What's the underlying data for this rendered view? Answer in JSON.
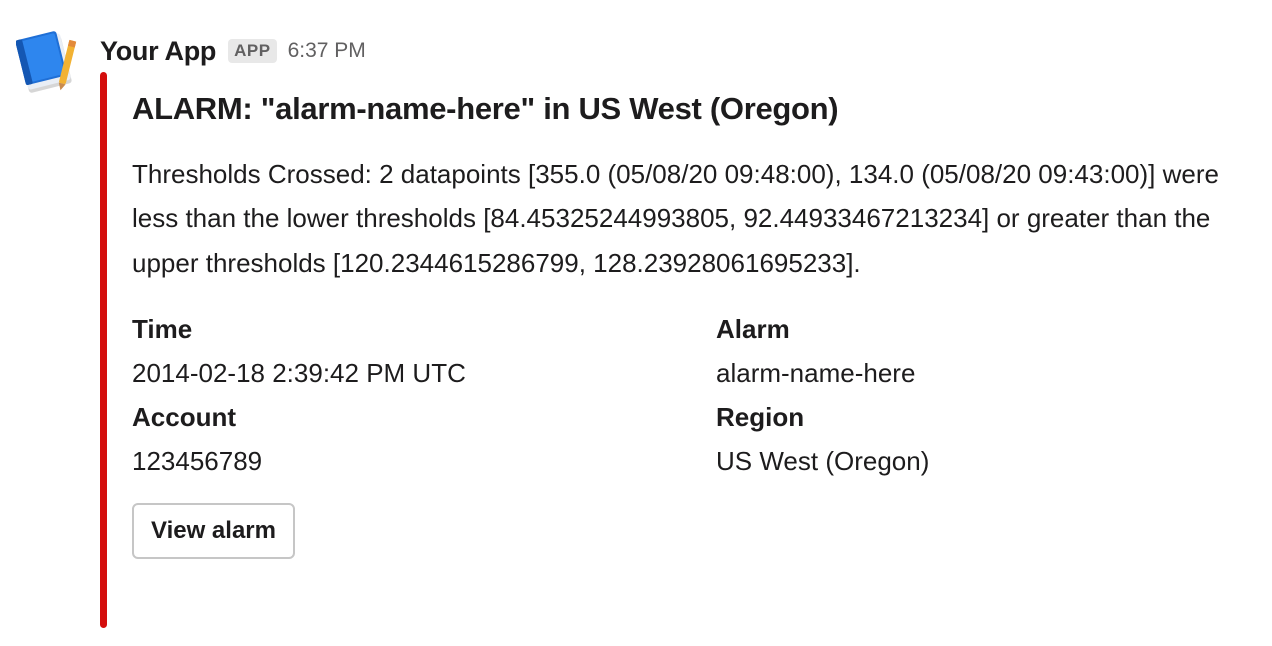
{
  "message": {
    "app_name": "Your App",
    "app_badge": "APP",
    "timestamp": "6:37 PM",
    "avatar_icon": "notebook-icon"
  },
  "attachment": {
    "color": "#d40e0d",
    "title": "ALARM: \"alarm-name-here\" in US West (Oregon)",
    "text": "Thresholds Crossed: 2 datapoints [355.0 (05/08/20 09:48:00), 134.0 (05/08/20 09:43:00)] were less than the lower thresholds [84.45325244993805, 92.44933467213234] or greater than the upper thresholds [120.2344615286799, 128.23928061695233].",
    "fields": [
      {
        "title": "Time",
        "value": "2014-02-18 2:39:42 PM UTC"
      },
      {
        "title": "Alarm",
        "value": "alarm-name-here"
      },
      {
        "title": "Account",
        "value": "123456789"
      },
      {
        "title": "Region",
        "value": "US West (Oregon)"
      }
    ],
    "action_label": "View alarm"
  }
}
